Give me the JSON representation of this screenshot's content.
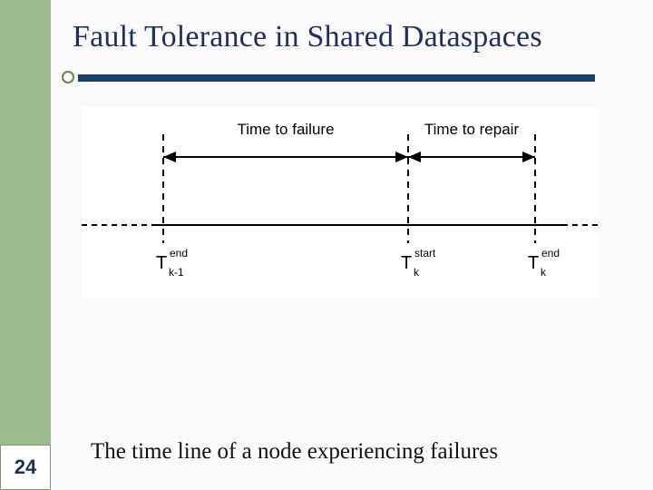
{
  "slide": {
    "title": "Fault Tolerance in Shared Dataspaces",
    "caption": "The time line of a node experiencing failures",
    "page_number": "24"
  },
  "figure": {
    "top_labels": {
      "ttf": "Time to failure",
      "ttr": "Time to repair"
    },
    "marks": [
      {
        "base": "T",
        "sub": "k-1",
        "sup": "end"
      },
      {
        "base": "T",
        "sub": "k",
        "sup": "start"
      },
      {
        "base": "T",
        "sub": "k",
        "sup": "end"
      }
    ]
  }
}
